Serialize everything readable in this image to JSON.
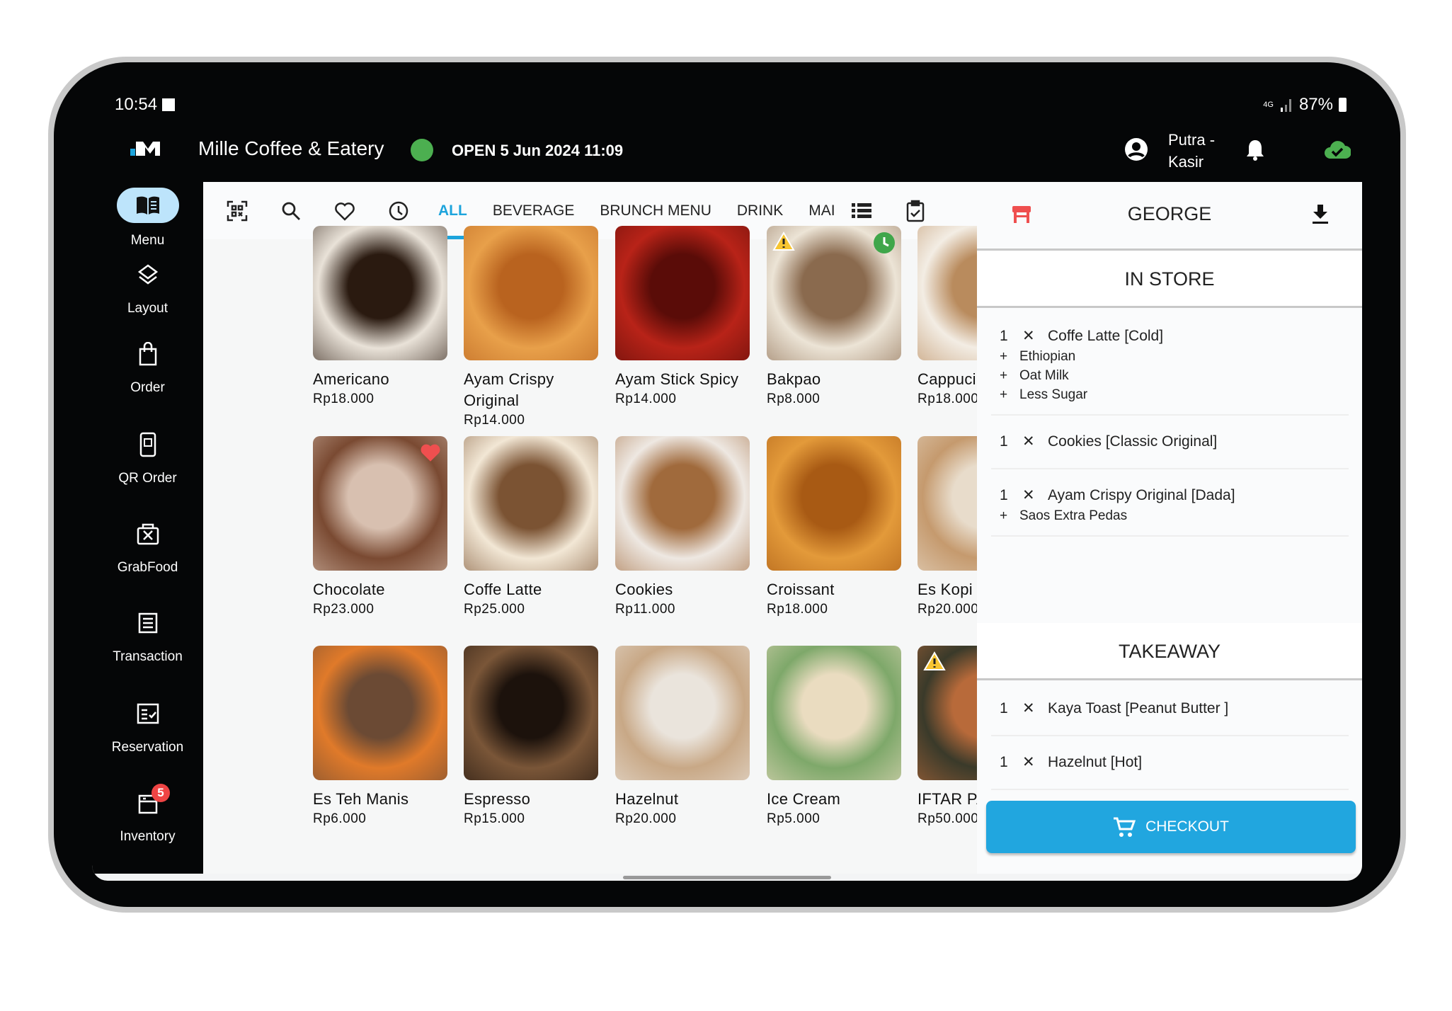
{
  "status_bar": {
    "time": "10:54",
    "network": "4G",
    "battery": "87%"
  },
  "header": {
    "title": "Mille Coffee & Eatery",
    "status": "OPEN 5 Jun 2024 11:09",
    "status_color": "#4caf50",
    "user": "Putra - Kasir",
    "user_line1": "Putra -",
    "user_line2": "Kasir"
  },
  "sidebar": {
    "items": [
      {
        "label": "Menu",
        "icon": "menu-book-icon",
        "active": true
      },
      {
        "label": "Layout",
        "icon": "layers-icon"
      },
      {
        "label": "Order",
        "icon": "shopping-bag-icon"
      },
      {
        "label": "QR Order",
        "icon": "qr-phone-icon"
      },
      {
        "label": "GrabFood",
        "icon": "grabfood-icon"
      },
      {
        "label": "Transaction",
        "icon": "receipt-icon"
      },
      {
        "label": "Reservation",
        "icon": "reservation-icon"
      },
      {
        "label": "Inventory",
        "icon": "inventory-icon",
        "badge": "5"
      }
    ]
  },
  "tabs": {
    "icons": [
      "qr-scan-icon",
      "search-icon",
      "heart-icon",
      "clock-icon"
    ],
    "items": [
      "ALL",
      "BEVERAGE",
      "BRUNCH MENU",
      "DRINK",
      "MAI"
    ],
    "active": "ALL",
    "accent": "#1da4dc"
  },
  "products": [
    {
      "name": "Americano",
      "price": "Rp18.000",
      "colors": [
        "#e9e2d8",
        "#2a1a10"
      ]
    },
    {
      "name": "Ayam Crispy Original",
      "price": "Rp14.000",
      "colors": [
        "#e8a04a",
        "#b9631f"
      ]
    },
    {
      "name": "Ayam Stick Spicy",
      "price": "Rp14.000",
      "colors": [
        "#b82318",
        "#5a0c08"
      ]
    },
    {
      "name": "Bakpao",
      "price": "Rp8.000",
      "colors": [
        "#ece4d6",
        "#8a6a4e"
      ],
      "warning": true,
      "clock": true
    },
    {
      "name": "Cappucino",
      "price": "Rp18.000",
      "colors": [
        "#f3ede4",
        "#b98b5d"
      ]
    },
    {
      "name": "Chocolate",
      "price": "Rp23.000",
      "colors": [
        "#7a4a32",
        "#d8c0b0"
      ],
      "favorite": true
    },
    {
      "name": "Coffe Latte",
      "price": "Rp25.000",
      "colors": [
        "#f2e7d5",
        "#7b5333"
      ]
    },
    {
      "name": "Cookies",
      "price": "Rp11.000",
      "colors": [
        "#eee8e2",
        "#a06a3c"
      ]
    },
    {
      "name": "Croissant",
      "price": "Rp18.000",
      "colors": [
        "#e39a3a",
        "#a85a14"
      ]
    },
    {
      "name": "Es Kopi Susu",
      "price": "Rp20.000",
      "colors": [
        "#c59a6e",
        "#e8dccb"
      ],
      "favorite": true
    },
    {
      "name": "Es Teh Manis",
      "price": "Rp6.000",
      "colors": [
        "#e07a2a",
        "#6b4a34"
      ]
    },
    {
      "name": "Espresso",
      "price": "Rp15.000",
      "colors": [
        "#7a5638",
        "#1c120c"
      ]
    },
    {
      "name": "Hazelnut",
      "price": "Rp20.000",
      "colors": [
        "#c8a886",
        "#eae4dc"
      ]
    },
    {
      "name": "Ice Cream",
      "price": "Rp5.000",
      "colors": [
        "#7ea86a",
        "#eadcc0"
      ]
    },
    {
      "name": "IFTAR PACKAGE",
      "price": "Rp50.000",
      "colors": [
        "#3a3a2a",
        "#b86a3a"
      ],
      "warning": true
    }
  ],
  "order_panel": {
    "table_name": "GEORGE",
    "sections": [
      {
        "title": "IN STORE",
        "items": [
          {
            "qty": "1",
            "name": "Coffe Latte [Cold]",
            "mods": [
              "Ethiopian",
              "Oat Milk",
              "Less Sugar"
            ]
          },
          {
            "qty": "1",
            "name": "Cookies [Classic Original]",
            "mods": []
          },
          {
            "qty": "1",
            "name": "Ayam Crispy Original [Dada]",
            "mods": [
              "Saos Extra Pedas"
            ]
          }
        ]
      },
      {
        "title": "TAKEAWAY",
        "items": [
          {
            "qty": "1",
            "name": "Kaya Toast [Peanut Butter ]",
            "mods": []
          },
          {
            "qty": "1",
            "name": "Hazelnut [Hot]",
            "mods": []
          }
        ]
      }
    ],
    "checkout_label": "CHECKOUT",
    "checkout_color": "#21a6df",
    "table_icon_color": "#ef4f4f"
  }
}
